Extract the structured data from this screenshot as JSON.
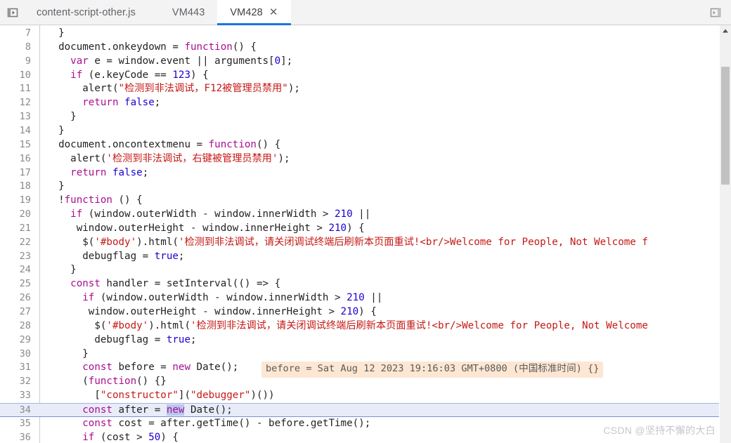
{
  "window": {
    "left_panel_toggle_icon": "panel-left-expand-icon",
    "right_panel_toggle_icon": "panel-right-expand-icon"
  },
  "tabbar": {
    "tabs": [
      {
        "label": "content-script-other.js",
        "active": false,
        "closable": false
      },
      {
        "label": "VM443",
        "active": false,
        "closable": false
      },
      {
        "label": "VM428",
        "active": true,
        "closable": true
      }
    ],
    "close_glyph": "✕",
    "active_underline_color": "#1a73e8"
  },
  "editor": {
    "first_line_number": 7,
    "current_line_number": 34,
    "selected_token": "new",
    "inline_value": "before = Sat Aug 12 2023 19:16:03 GMT+0800 (中国标准时间) {}",
    "lines": [
      {
        "n": 7,
        "text": "  }"
      },
      {
        "n": 8,
        "text": "  document.onkeydown = function() {"
      },
      {
        "n": 9,
        "text": "    var e = window.event || arguments[0];"
      },
      {
        "n": 10,
        "text": "    if (e.keyCode == 123) {"
      },
      {
        "n": 11,
        "text": "      alert(\"检测到非法调试，F12被管理员禁用\");"
      },
      {
        "n": 12,
        "text": "      return false;"
      },
      {
        "n": 13,
        "text": "    }"
      },
      {
        "n": 14,
        "text": "  }"
      },
      {
        "n": 15,
        "text": "  document.oncontextmenu = function() {"
      },
      {
        "n": 16,
        "text": "    alert('检测到非法调试，右键被管理员禁用');"
      },
      {
        "n": 17,
        "text": "    return false;"
      },
      {
        "n": 18,
        "text": "  }"
      },
      {
        "n": 19,
        "text": "  !function () {"
      },
      {
        "n": 20,
        "text": "    if (window.outerWidth - window.innerWidth > 210 ||"
      },
      {
        "n": 21,
        "text": "     window.outerHeight - window.innerHeight > 210) {"
      },
      {
        "n": 22,
        "text": "      $('#body').html('检测到非法调试，请关闭调试终端后刷新本页面重试!<br/>Welcome for People, Not Welcome f"
      },
      {
        "n": 23,
        "text": "      debugflag = true;"
      },
      {
        "n": 24,
        "text": "    }"
      },
      {
        "n": 25,
        "text": "    const handler = setInterval(() => {"
      },
      {
        "n": 26,
        "text": "      if (window.outerWidth - window.innerWidth > 210 ||"
      },
      {
        "n": 27,
        "text": "       window.outerHeight - window.innerHeight > 210) {"
      },
      {
        "n": 28,
        "text": "        $('#body').html('检测到非法调试，请关闭调试终端后刷新本页面重试!<br/>Welcome for People, Not Welcome"
      },
      {
        "n": 29,
        "text": "        debugflag = true;"
      },
      {
        "n": 30,
        "text": "      }"
      },
      {
        "n": 31,
        "text": "      const before = new Date();"
      },
      {
        "n": 32,
        "text": "      (function() {}"
      },
      {
        "n": 33,
        "text": "        [\"constructor\"](\"debugger\")())"
      },
      {
        "n": 34,
        "text": "      const after = new Date();"
      },
      {
        "n": 35,
        "text": "      const cost = after.getTime() - before.getTime();"
      },
      {
        "n": 36,
        "text": "      if (cost > 50) {"
      }
    ]
  },
  "scrollbar": {
    "up_arrow_icon": "triangle-up-icon",
    "orientation": "vertical"
  },
  "watermark": {
    "text": "CSDN @坚持不懈的大白"
  }
}
